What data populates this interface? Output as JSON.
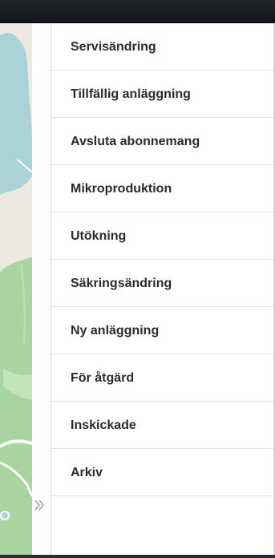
{
  "sidebar": {
    "items": [
      {
        "label": "Servisändring"
      },
      {
        "label": "Tillfällig anläggning"
      },
      {
        "label": "Avsluta abonnemang"
      },
      {
        "label": "Mikroproduktion"
      },
      {
        "label": "Utökning"
      },
      {
        "label": "Säkringsändring"
      },
      {
        "label": "Ny anläggning"
      },
      {
        "label": "För åtgärd"
      },
      {
        "label": "Inskickade"
      },
      {
        "label": "Arkiv"
      }
    ]
  },
  "map": {
    "colors": {
      "land": "#ece9e2",
      "water": "#aad3d8",
      "forest": "#a9d5a0"
    }
  },
  "collapse_handle_icon": "double-chevron-right-icon"
}
